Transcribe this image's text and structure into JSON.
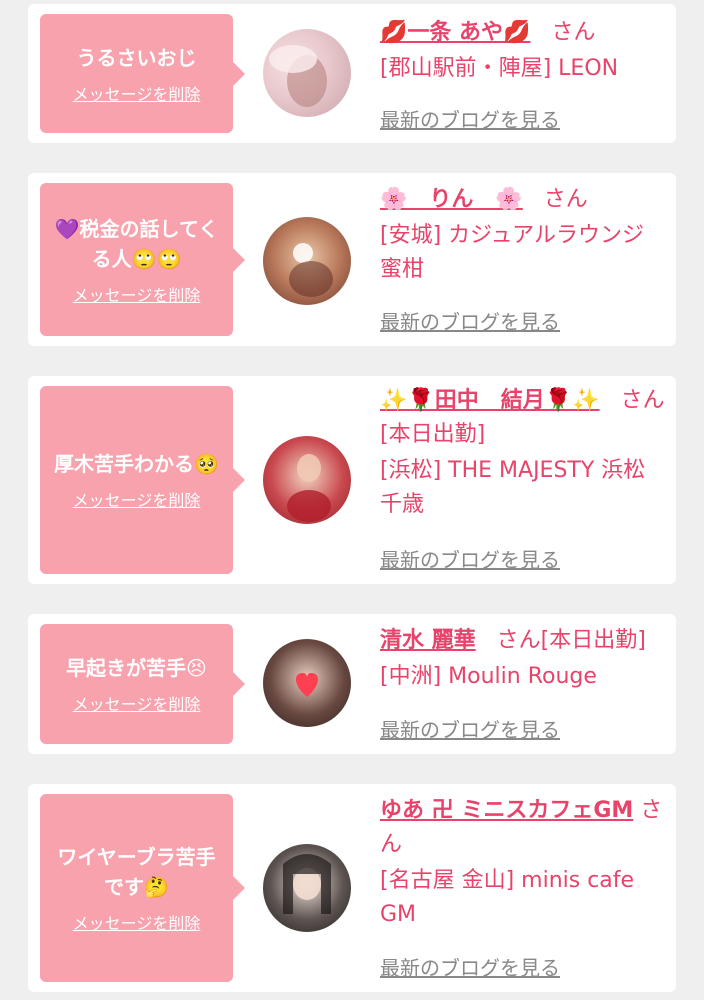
{
  "entries": [
    {
      "message": "うるさいおじ",
      "delete_label": "メッセージを削除",
      "name": "💋一条 あや💋",
      "san": "さん",
      "shop": "[郡山駅前・陣屋] LEON",
      "blog_label": "最新のブログを見る"
    },
    {
      "message": "💜税金の話してくる人🙄🙄",
      "delete_label": "メッセージを削除",
      "name": "🌸　りん　🌸",
      "san": "さん",
      "shop": "[安城] カジュアルラウンジ　蜜柑",
      "blog_label": "最新のブログを見る"
    },
    {
      "message": "厚木苦手わかる🥺",
      "delete_label": "メッセージを削除",
      "name": "✨🌹田中　結月🌹✨",
      "san": "さん[本日出勤]",
      "shop": "[浜松] THE MAJESTY 浜松千歳",
      "blog_label": "最新のブログを見る"
    },
    {
      "message": "早起きが苦手😣",
      "delete_label": "メッセージを削除",
      "name": "清水 麗華",
      "san": "さん[本日出勤]",
      "shop": "[中洲] Moulin Rouge",
      "blog_label": "最新のブログを見る"
    },
    {
      "message": "ワイヤーブラ苦手です🤔",
      "delete_label": "メッセージを削除",
      "name": "ゆあ 卍 ミニスカフェGM",
      "san": "さん",
      "shop": "[名古屋 金山] minis cafe GM",
      "blog_label": "最新のブログを見る"
    }
  ],
  "colors": {
    "background": "#efefef",
    "bubble": "#f7a2ad",
    "accent": "#e8436a",
    "muted_link": "#888888"
  }
}
